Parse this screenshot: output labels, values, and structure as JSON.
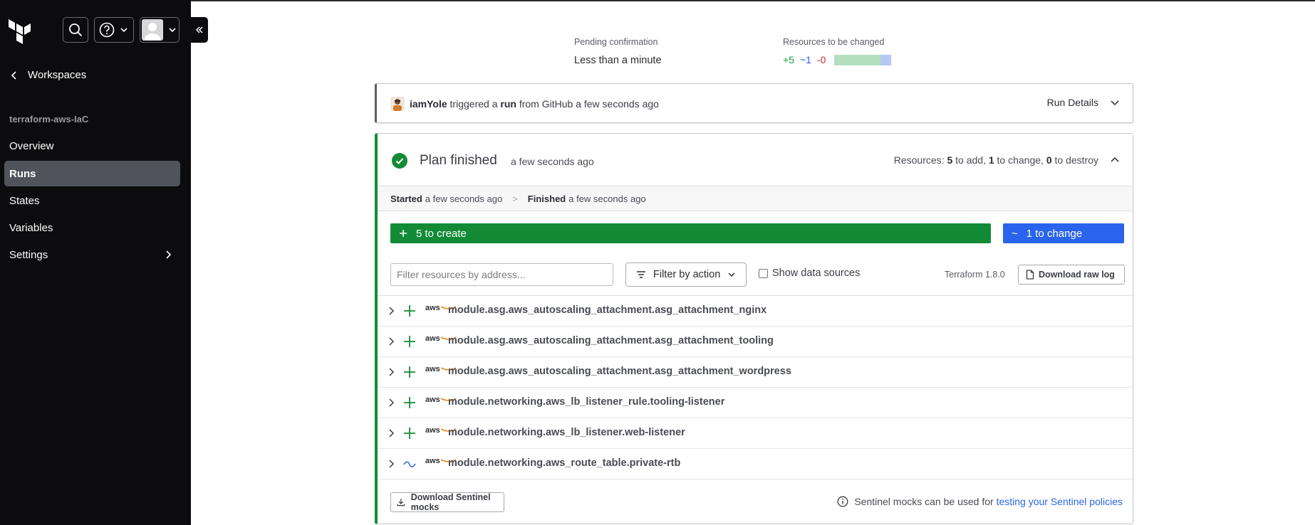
{
  "sidebar": {
    "back_label": "Workspaces",
    "workspace_name": "terraform-aws-IaC",
    "items": [
      {
        "label": "Overview"
      },
      {
        "label": "Runs"
      },
      {
        "label": "States"
      },
      {
        "label": "Variables"
      },
      {
        "label": "Settings"
      }
    ]
  },
  "summary": {
    "pending_label": "Pending confirmation",
    "pending_value": "Less than a minute",
    "resources_label": "Resources to be changed",
    "add_count": "+5",
    "change_count": "~1",
    "destroy_count": "-0"
  },
  "trigger": {
    "user": "iamYole",
    "text_1": "triggered a",
    "run_word": "run",
    "text_2": "from GitHub a few seconds ago",
    "details_label": "Run Details"
  },
  "plan": {
    "title": "Plan finished",
    "time": "a few seconds ago",
    "resources_prefix": "Resources:",
    "add_num": "5",
    "add_text": "to add,",
    "change_num": "1",
    "change_text": "to change,",
    "destroy_num": "0",
    "destroy_text": "to destroy",
    "started_label": "Started",
    "started_time": "a few seconds ago",
    "finished_label": "Finished",
    "finished_time": "a few seconds ago",
    "create_label": "5 to create",
    "change_label": "1 to change",
    "filter_placeholder": "Filter resources by address...",
    "filter_action_label": "Filter by action",
    "show_data_sources_label": "Show data sources",
    "terraform_version": "Terraform 1.8.0",
    "download_raw_log_label": "Download raw log",
    "provider_label": "aws",
    "resources": [
      {
        "address": "module.asg.aws_autoscaling_attachment.asg_attachment_nginx",
        "action": "create"
      },
      {
        "address": "module.asg.aws_autoscaling_attachment.asg_attachment_tooling",
        "action": "create"
      },
      {
        "address": "module.asg.aws_autoscaling_attachment.asg_attachment_wordpress",
        "action": "create"
      },
      {
        "address": "module.networking.aws_lb_listener_rule.tooling-listener",
        "action": "create"
      },
      {
        "address": "module.networking.aws_lb_listener.web-listener",
        "action": "create"
      },
      {
        "address": "module.networking.aws_route_table.private-rtb",
        "action": "change"
      }
    ],
    "download_sentinel_label": "Download Sentinel mocks",
    "sentinel_note": "Sentinel mocks can be used for",
    "sentinel_link": "testing your Sentinel policies"
  },
  "colors": {
    "create": "#138a36",
    "change": "#2a64ec",
    "destroy": "#c62d3a",
    "sidebar_bg": "#0c0c0e"
  }
}
